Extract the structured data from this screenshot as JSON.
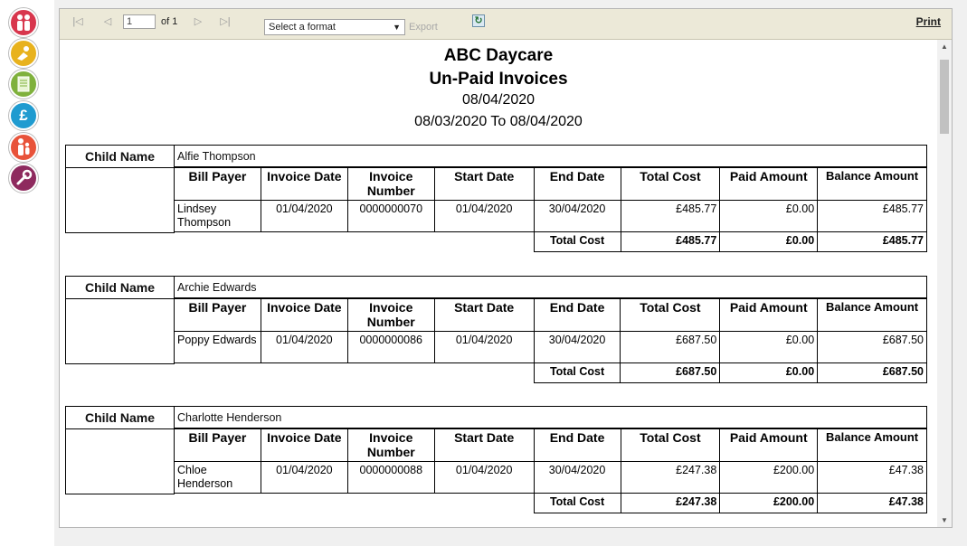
{
  "sidebar": {
    "items": [
      {
        "icon": "family-icon",
        "color": "#d8364d"
      },
      {
        "icon": "child-play-icon",
        "color": "#e8b21d"
      },
      {
        "icon": "document-icon",
        "color": "#7fb13c"
      },
      {
        "icon": "pound-icon",
        "color": "#1f9bd0"
      },
      {
        "icon": "people-icon",
        "color": "#e8533a"
      },
      {
        "icon": "wrench-icon",
        "color": "#8e2a5e"
      }
    ]
  },
  "toolbar": {
    "page_value": "1",
    "of_label": "of 1",
    "format_placeholder": "Select a format",
    "export_label": "Export",
    "print_label": "Print"
  },
  "report": {
    "company": "ABC Daycare",
    "title": "Un-Paid Invoices",
    "date": "08/04/2020",
    "range": "08/03/2020 To 08/04/2020",
    "child_name_label": "Child Name",
    "columns": {
      "bill_payer": "Bill Payer",
      "invoice_date": "Invoice Date",
      "invoice_number": "Invoice Number",
      "start_date": "Start Date",
      "end_date": "End Date",
      "total_cost": "Total Cost",
      "paid_amount": "Paid Amount",
      "balance_amount": "Balance Amount"
    },
    "total_cost_label": "Total Cost",
    "children": [
      {
        "child_name": "Alfie Thompson",
        "bill_payer": "Lindsey Thompson",
        "invoice_date": "01/04/2020",
        "invoice_number": "0000000070",
        "start_date": "01/04/2020",
        "end_date": "30/04/2020",
        "total_cost": "£485.77",
        "paid_amount": "£0.00",
        "balance_amount": "£485.77",
        "sum_total_cost": "£485.77",
        "sum_paid_amount": "£0.00",
        "sum_balance_amount": "£485.77"
      },
      {
        "child_name": "Archie Edwards",
        "bill_payer": "Poppy Edwards",
        "invoice_date": "01/04/2020",
        "invoice_number": "0000000086",
        "start_date": "01/04/2020",
        "end_date": "30/04/2020",
        "total_cost": "£687.50",
        "paid_amount": "£0.00",
        "balance_amount": "£687.50",
        "sum_total_cost": "£687.50",
        "sum_paid_amount": "£0.00",
        "sum_balance_amount": "£687.50"
      },
      {
        "child_name": "Charlotte Henderson",
        "bill_payer": "Chloe Henderson",
        "invoice_date": "01/04/2020",
        "invoice_number": "0000000088",
        "start_date": "01/04/2020",
        "end_date": "30/04/2020",
        "total_cost": "£247.38",
        "paid_amount": "£200.00",
        "balance_amount": "£47.38",
        "sum_total_cost": "£247.38",
        "sum_paid_amount": "£200.00",
        "sum_balance_amount": "£47.38"
      }
    ]
  }
}
